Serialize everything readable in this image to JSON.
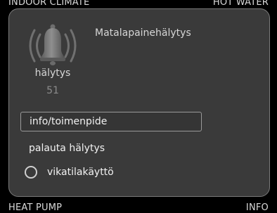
{
  "background_labels": {
    "top_left": "INDOOR CLIMATE",
    "top_right": "HOT WATER",
    "bottom_left": "HEAT PUMP",
    "bottom_right": "INFO"
  },
  "alarm": {
    "title": "Matalapainehälytys",
    "label": "hälytys",
    "code": "51",
    "icon": "alarm-bell-icon"
  },
  "menu": {
    "items": [
      {
        "label": "info/toimenpide",
        "selected": true
      },
      {
        "label": "palauta hälytys",
        "selected": false
      },
      {
        "label": "vikatilakäyttö",
        "type": "radio",
        "checked": false
      }
    ]
  },
  "colors": {
    "panel_bg": "#3a3a3a",
    "panel_border": "#7a7a7a",
    "screen_bg": "#000000"
  }
}
